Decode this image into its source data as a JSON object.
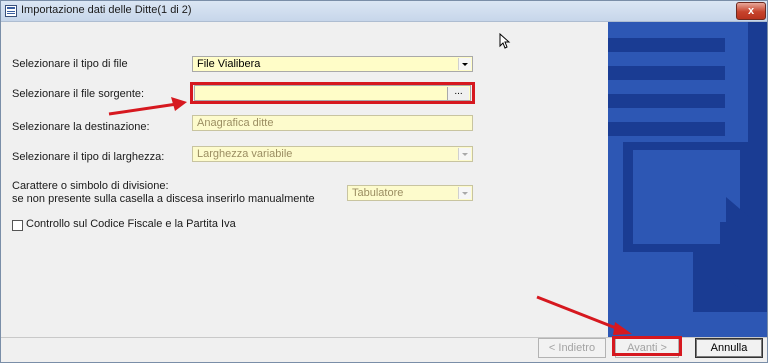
{
  "window": {
    "title": "Importazione dati delle Ditte(1 di 2)",
    "close_label": "x"
  },
  "form": {
    "tipo_file_label": "Selezionare il tipo di file",
    "tipo_file_value": "File Vialibera",
    "file_sorgente_label": "Selezionare il file sorgente:",
    "file_sorgente_value": "",
    "browse_label": "...",
    "destinazione_label": "Selezionare la destinazione:",
    "destinazione_value": "Anagrafica ditte",
    "larghezza_label": "Selezionare il tipo di larghezza:",
    "larghezza_value": "Larghezza variabile",
    "carattere_label_line1": "Carattere o simbolo di divisione:",
    "carattere_label_line2": "se non presente sulla casella a discesa inserirlo manualmente",
    "carattere_value": "Tabulatore",
    "controllo_label": "Controllo sul Codice Fiscale e la Partita Iva",
    "controllo_checked": false
  },
  "buttons": {
    "indietro_label": "< Indietro",
    "avanti_label": "Avanti >",
    "annulla_label": "Annulla"
  },
  "colors": {
    "panel_blue": "#2d57b4",
    "panel_dark_blue": "#1a3c93",
    "highlight_red": "#d6181f",
    "field_yellow": "#fffdc8"
  },
  "icons": {
    "window_icon": "form-icon",
    "dropdown": "chevron-down-icon",
    "panel_art": "arrow-curve-icon",
    "cursor": "mouse-pointer-icon"
  }
}
